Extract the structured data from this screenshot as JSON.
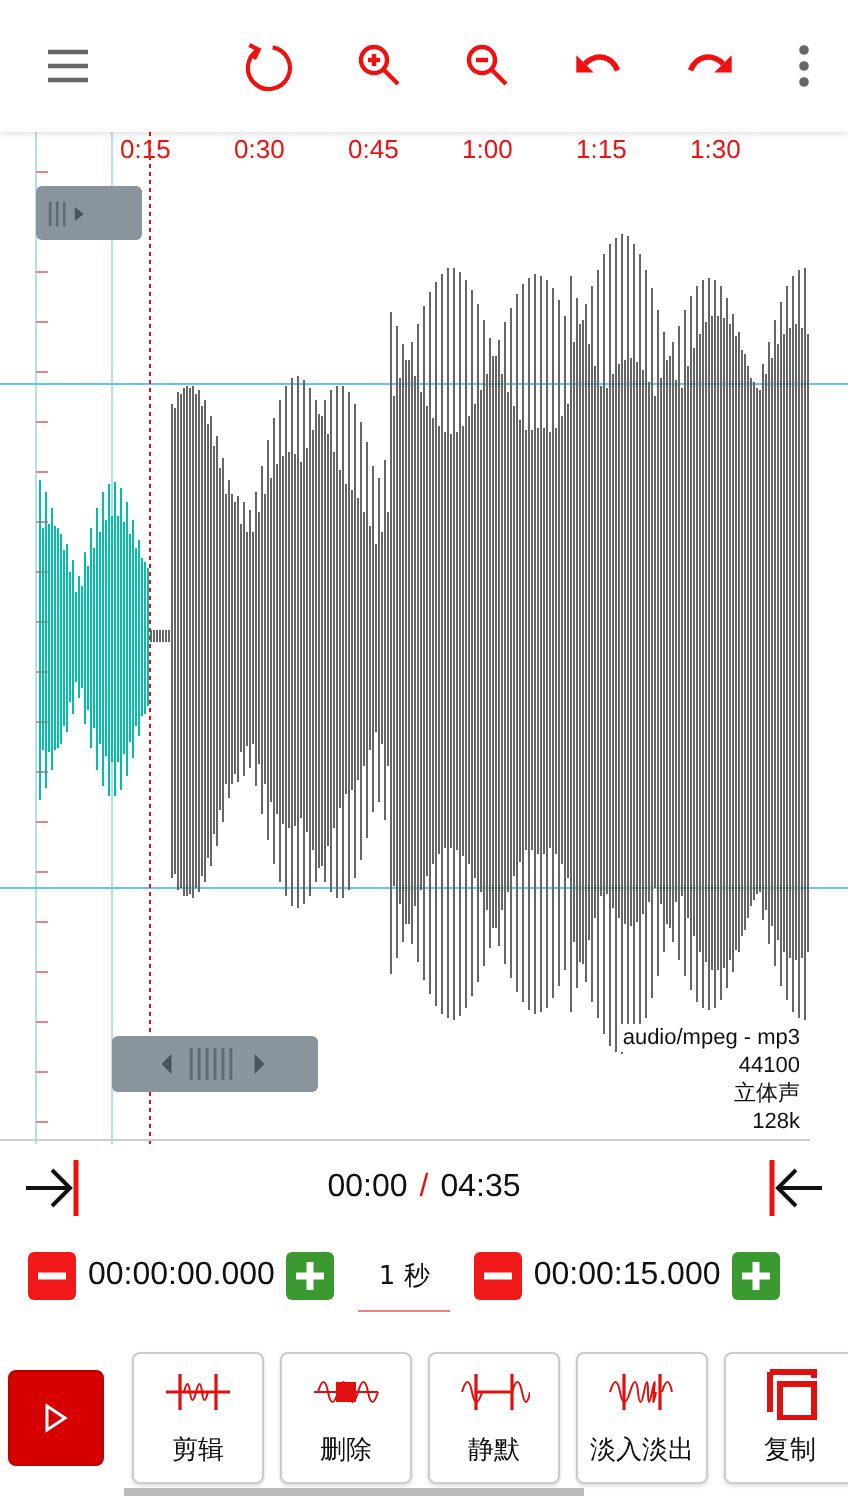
{
  "timeline": {
    "labels": [
      "0:15",
      "0:30",
      "0:45",
      "1:00",
      "1:15",
      "1:30"
    ]
  },
  "file_info": [
    "audio/mpeg - mp3",
    "44100",
    "立体声",
    "128k"
  ],
  "playback": {
    "current": "00:00",
    "separator": "/",
    "total": "04:35"
  },
  "range": {
    "start": "00:00:00.000",
    "step": "1 秒",
    "end": "00:00:15.000"
  },
  "tools": [
    {
      "kind": "cut",
      "label": "剪辑"
    },
    {
      "kind": "delete",
      "label": "删除"
    },
    {
      "kind": "silence",
      "label": "静默"
    },
    {
      "kind": "fade",
      "label": "淡入淡出"
    },
    {
      "kind": "copy",
      "label": "复制"
    }
  ]
}
